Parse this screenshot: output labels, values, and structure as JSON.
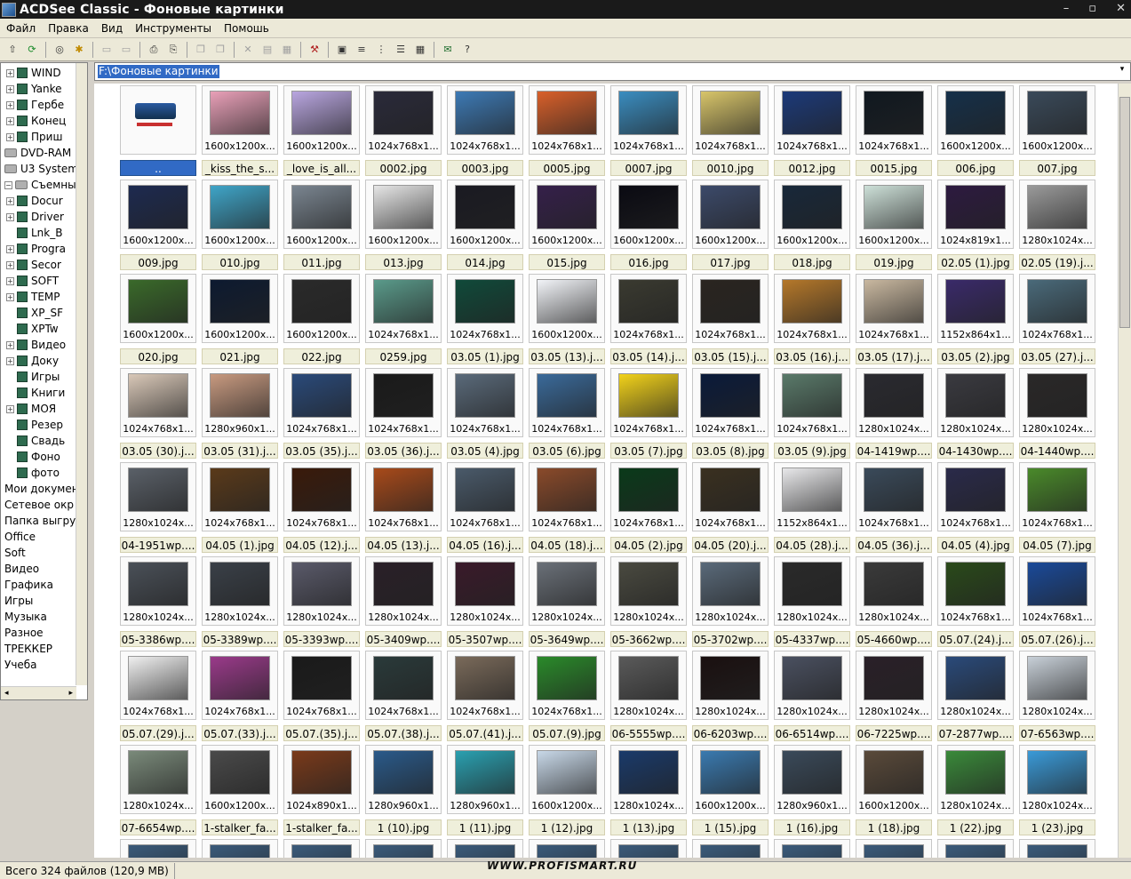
{
  "window": {
    "title": "ACDSee Classic - Фоновые картинки",
    "min": "–",
    "max": "▫",
    "close": "✕"
  },
  "menu": [
    "Файл",
    "Правка",
    "Вид",
    "Инструменты",
    "Помошь"
  ],
  "toolbar": [
    "up-icon",
    "refresh-icon",
    "binoculars-icon",
    "favorite-icon",
    "view-icon",
    "compare-icon",
    "print-icon",
    "scan-icon",
    "copy-icon",
    "paste-icon",
    "delete-icon",
    "rename-icon",
    "properties-icon",
    "tools-icon",
    "thumbs-icon",
    "list-icon",
    "tree-icon",
    "details-icon",
    "grid-icon",
    "email-icon",
    "help-icon"
  ],
  "tree": [
    {
      "label": "WIND",
      "type": "folder",
      "expander": "+"
    },
    {
      "label": "Yanke",
      "type": "folder",
      "expander": "+"
    },
    {
      "label": "Гербе",
      "type": "folder",
      "expander": "+"
    },
    {
      "label": "Конец",
      "type": "folder",
      "expander": "+"
    },
    {
      "label": "Приш",
      "type": "folder",
      "expander": "+"
    },
    {
      "label": "DVD-RAM",
      "type": "drive",
      "expander": ""
    },
    {
      "label": "U3 System",
      "type": "drive",
      "expander": ""
    },
    {
      "label": "Съемный",
      "type": "drive",
      "expander": "−"
    },
    {
      "label": "Docur",
      "type": "folder",
      "expander": "+"
    },
    {
      "label": "Driver",
      "type": "folder",
      "expander": "+"
    },
    {
      "label": "Lnk_B",
      "type": "folder",
      "expander": ""
    },
    {
      "label": "Progra",
      "type": "folder",
      "expander": "+"
    },
    {
      "label": "Secor",
      "type": "folder",
      "expander": "+"
    },
    {
      "label": "SOFT",
      "type": "folder",
      "expander": "+"
    },
    {
      "label": "TEMP",
      "type": "folder",
      "expander": "+"
    },
    {
      "label": "XP_SF",
      "type": "folder",
      "expander": ""
    },
    {
      "label": "XPTw",
      "type": "folder",
      "expander": ""
    },
    {
      "label": "Видео",
      "type": "folder",
      "expander": "+"
    },
    {
      "label": "Доку",
      "type": "folder",
      "expander": "+"
    },
    {
      "label": "Игры",
      "type": "folder",
      "expander": ""
    },
    {
      "label": "Книги",
      "type": "folder",
      "expander": ""
    },
    {
      "label": "МОЯ",
      "type": "folder",
      "expander": "+"
    },
    {
      "label": "Резер",
      "type": "folder",
      "expander": ""
    },
    {
      "label": "Свадь",
      "type": "folder",
      "expander": ""
    },
    {
      "label": "Фоно",
      "type": "folder",
      "expander": ""
    },
    {
      "label": "фото",
      "type": "folder",
      "expander": ""
    },
    {
      "label": "Мои докумен",
      "type": "plain",
      "expander": ""
    },
    {
      "label": "Сетевое окр",
      "type": "plain",
      "expander": ""
    },
    {
      "label": "Папка выгру",
      "type": "plain",
      "expander": ""
    },
    {
      "label": "Office",
      "type": "plain",
      "expander": ""
    },
    {
      "label": "Soft",
      "type": "plain",
      "expander": ""
    },
    {
      "label": "Видео",
      "type": "plain",
      "expander": ""
    },
    {
      "label": "Графика",
      "type": "plain",
      "expander": ""
    },
    {
      "label": "Игры",
      "type": "plain",
      "expander": ""
    },
    {
      "label": "Музыка",
      "type": "plain",
      "expander": ""
    },
    {
      "label": "Разное",
      "type": "plain",
      "expander": ""
    },
    {
      "label": "ТРЕККЕР",
      "type": "plain",
      "expander": ""
    },
    {
      "label": "Учеба",
      "type": "plain",
      "expander": ""
    }
  ],
  "tree_scroll": {
    "left": "◂",
    "right": "▸"
  },
  "path": {
    "value": "F:\\Фоновые картинки",
    "dropdown": "▾"
  },
  "tiles": [
    {
      "dim": "",
      "name": "..",
      "color": "#ffffff",
      "selected": true
    },
    {
      "dim": "1600x1200x...",
      "name": "_kiss_the_s...",
      "color": "#e9a0b8"
    },
    {
      "dim": "1600x1200x...",
      "name": "_love_is_all...",
      "color": "#b9a6e0"
    },
    {
      "dim": "1024x768x1...",
      "name": "0002.jpg",
      "color": "#2a2a3a"
    },
    {
      "dim": "1024x768x1...",
      "name": "0003.jpg",
      "color": "#3d7ab5"
    },
    {
      "dim": "1024x768x1...",
      "name": "0005.jpg",
      "color": "#d9602a"
    },
    {
      "dim": "1024x768x1...",
      "name": "0007.jpg",
      "color": "#3a8dc0"
    },
    {
      "dim": "1024x768x1...",
      "name": "0010.jpg",
      "color": "#d8c56a"
    },
    {
      "dim": "1024x768x1...",
      "name": "0012.jpg",
      "color": "#1c3a7a"
    },
    {
      "dim": "1024x768x1...",
      "name": "0015.jpg",
      "color": "#101820"
    },
    {
      "dim": "1600x1200x...",
      "name": "006.jpg",
      "color": "#15304a"
    },
    {
      "dim": "1600x1200x...",
      "name": "007.jpg",
      "color": "#3a4a5a"
    },
    {
      "dim": "1600x1200x...",
      "name": "009.jpg",
      "color": "#1d2a50"
    },
    {
      "dim": "1600x1200x...",
      "name": "010.jpg",
      "color": "#3fa5c8"
    },
    {
      "dim": "1600x1200x...",
      "name": "011.jpg",
      "color": "#7a8590"
    },
    {
      "dim": "1600x1200x...",
      "name": "013.jpg",
      "color": "#e6e6e6"
    },
    {
      "dim": "1600x1200x...",
      "name": "014.jpg",
      "color": "#1a1a22"
    },
    {
      "dim": "1600x1200x...",
      "name": "015.jpg",
      "color": "#35204a"
    },
    {
      "dim": "1600x1200x...",
      "name": "016.jpg",
      "color": "#0a0a12"
    },
    {
      "dim": "1600x1200x...",
      "name": "017.jpg",
      "color": "#3c4a6a"
    },
    {
      "dim": "1600x1200x...",
      "name": "018.jpg",
      "color": "#18283a"
    },
    {
      "dim": "1600x1200x...",
      "name": "019.jpg",
      "color": "#cde0d8"
    },
    {
      "dim": "1024x819x1...",
      "name": "02.05 (1).jpg",
      "color": "#2d1a40"
    },
    {
      "dim": "1280x1024x...",
      "name": "02.05 (19).j...",
      "color": "#9a9a9a"
    },
    {
      "dim": "1600x1200x...",
      "name": "020.jpg",
      "color": "#3a6a2a"
    },
    {
      "dim": "1600x1200x...",
      "name": "021.jpg",
      "color": "#0d1a30"
    },
    {
      "dim": "1600x1200x...",
      "name": "022.jpg",
      "color": "#2a2a2a"
    },
    {
      "dim": "1024x768x1...",
      "name": "0259.jpg",
      "color": "#5a9a8a"
    },
    {
      "dim": "1024x768x1...",
      "name": "03.05 (1).jpg",
      "color": "#104a3a"
    },
    {
      "dim": "1600x1200x...",
      "name": "03.05 (13).j...",
      "color": "#f2f4f8"
    },
    {
      "dim": "1024x768x1...",
      "name": "03.05 (14).j...",
      "color": "#3a3a30"
    },
    {
      "dim": "1024x768x1...",
      "name": "03.05 (15).j...",
      "color": "#2a2520"
    },
    {
      "dim": "1024x768x1...",
      "name": "03.05 (16).j...",
      "color": "#b5782a"
    },
    {
      "dim": "1024x768x1...",
      "name": "03.05 (17).j...",
      "color": "#c9b8a0"
    },
    {
      "dim": "1152x864x1...",
      "name": "03.05 (2).jpg",
      "color": "#3a2a6a"
    },
    {
      "dim": "1024x768x1...",
      "name": "03.05 (27).j...",
      "color": "#4a6a7a"
    },
    {
      "dim": "1024x768x1...",
      "name": "03.05 (30).j...",
      "color": "#d9c8b8"
    },
    {
      "dim": "1280x960x1...",
      "name": "03.05 (31).j...",
      "color": "#c89a80"
    },
    {
      "dim": "1024x768x1...",
      "name": "03.05 (35).j...",
      "color": "#2a4a7a"
    },
    {
      "dim": "1024x768x1...",
      "name": "03.05 (36).j...",
      "color": "#1a1a1a"
    },
    {
      "dim": "1024x768x1...",
      "name": "03.05 (4).jpg",
      "color": "#5a6a7a"
    },
    {
      "dim": "1024x768x1...",
      "name": "03.05 (6).jpg",
      "color": "#3a6a9a"
    },
    {
      "dim": "1024x768x1...",
      "name": "03.05 (7).jpg",
      "color": "#f2d21a"
    },
    {
      "dim": "1024x768x1...",
      "name": "03.05 (8).jpg",
      "color": "#0a1a3a"
    },
    {
      "dim": "1024x768x1...",
      "name": "03.05 (9).jpg",
      "color": "#5a7a6a"
    },
    {
      "dim": "1280x1024x...",
      "name": "04-1419wp....",
      "color": "#2a2a30"
    },
    {
      "dim": "1280x1024x...",
      "name": "04-1430wp....",
      "color": "#3a3a40"
    },
    {
      "dim": "1280x1024x...",
      "name": "04-1440wp....",
      "color": "#2a2828"
    },
    {
      "dim": "1280x1024x...",
      "name": "04-1951wp....",
      "color": "#5a6068"
    },
    {
      "dim": "1024x768x1...",
      "name": "04.05 (1).jpg",
      "color": "#5a3a1a"
    },
    {
      "dim": "1024x768x1...",
      "name": "04.05 (12).j...",
      "color": "#3a1a0a"
    },
    {
      "dim": "1024x768x1...",
      "name": "04.05 (13).j...",
      "color": "#a84a1a"
    },
    {
      "dim": "1024x768x1...",
      "name": "04.05 (16).j...",
      "color": "#4a5a6a"
    },
    {
      "dim": "1024x768x1...",
      "name": "04.05 (18).j...",
      "color": "#8a4a2a"
    },
    {
      "dim": "1024x768x1...",
      "name": "04.05 (2).jpg",
      "color": "#0a3a1a"
    },
    {
      "dim": "1024x768x1...",
      "name": "04.05 (20).j...",
      "color": "#3a3020"
    },
    {
      "dim": "1152x864x1...",
      "name": "04.05 (28).j...",
      "color": "#e8e8ea"
    },
    {
      "dim": "1024x768x1...",
      "name": "04.05 (36).j...",
      "color": "#3a4a5a"
    },
    {
      "dim": "1024x768x1...",
      "name": "04.05 (4).jpg",
      "color": "#2a2a4a"
    },
    {
      "dim": "1024x768x1...",
      "name": "04.05 (7).jpg",
      "color": "#4a8a2a"
    },
    {
      "dim": "1280x1024x...",
      "name": "05-3386wp....",
      "color": "#4a5058"
    },
    {
      "dim": "1280x1024x...",
      "name": "05-3389wp....",
      "color": "#3a4048"
    },
    {
      "dim": "1280x1024x...",
      "name": "05-3393wp....",
      "color": "#5a5a6a"
    },
    {
      "dim": "1280x1024x...",
      "name": "05-3409wp....",
      "color": "#2a2028"
    },
    {
      "dim": "1280x1024x...",
      "name": "05-3507wp....",
      "color": "#3a1a2a"
    },
    {
      "dim": "1280x1024x...",
      "name": "05-3649wp....",
      "color": "#6a7078"
    },
    {
      "dim": "1280x1024x...",
      "name": "05-3662wp....",
      "color": "#4a4a40"
    },
    {
      "dim": "1280x1024x...",
      "name": "05-3702wp....",
      "color": "#5a6a7a"
    },
    {
      "dim": "1280x1024x...",
      "name": "05-4337wp....",
      "color": "#2a2a2a"
    },
    {
      "dim": "1280x1024x...",
      "name": "05-4660wp....",
      "color": "#3a3a3a"
    },
    {
      "dim": "1024x768x1...",
      "name": "05.07.(24).j...",
      "color": "#2a4a1a"
    },
    {
      "dim": "1024x768x1...",
      "name": "05.07.(26).j...",
      "color": "#1a4a9a"
    },
    {
      "dim": "1024x768x1...",
      "name": "05.07.(29).j...",
      "color": "#f0f0f0"
    },
    {
      "dim": "1024x768x1...",
      "name": "05.07.(33).j...",
      "color": "#9a3a8a"
    },
    {
      "dim": "1024x768x1...",
      "name": "05.07.(35).j...",
      "color": "#1a1a1a"
    },
    {
      "dim": "1024x768x1...",
      "name": "05.07.(38).j...",
      "color": "#2a3a3a"
    },
    {
      "dim": "1024x768x1...",
      "name": "05.07.(41).j...",
      "color": "#7a6a5a"
    },
    {
      "dim": "1024x768x1...",
      "name": "05.07.(9).jpg",
      "color": "#2a8a2a"
    },
    {
      "dim": "1280x1024x...",
      "name": "06-5555wp....",
      "color": "#5a5a5a"
    },
    {
      "dim": "1280x1024x...",
      "name": "06-6203wp....",
      "color": "#1a1010"
    },
    {
      "dim": "1280x1024x...",
      "name": "06-6514wp....",
      "color": "#4a5060"
    },
    {
      "dim": "1280x1024x...",
      "name": "06-7225wp....",
      "color": "#2a2028"
    },
    {
      "dim": "1280x1024x...",
      "name": "07-2877wp....",
      "color": "#2a4a7a"
    },
    {
      "dim": "1280x1024x...",
      "name": "07-6563wp....",
      "color": "#c8d0d8"
    },
    {
      "dim": "1280x1024x...",
      "name": "07-6654wp....",
      "color": "#7a8a7a"
    },
    {
      "dim": "1600x1200x...",
      "name": "1-stalker_fa...",
      "color": "#4a4a4a"
    },
    {
      "dim": "1024x890x1...",
      "name": "1-stalker_fa...",
      "color": "#7a3a1a"
    },
    {
      "dim": "1280x960x1...",
      "name": "1 (10).jpg",
      "color": "#2a5a8a"
    },
    {
      "dim": "1280x960x1...",
      "name": "1 (11).jpg",
      "color": "#2aa0b0"
    },
    {
      "dim": "1600x1200x...",
      "name": "1 (12).jpg",
      "color": "#c8d8e8"
    },
    {
      "dim": "1280x1024x...",
      "name": "1 (13).jpg",
      "color": "#1a3a6a"
    },
    {
      "dim": "1600x1200x...",
      "name": "1 (15).jpg",
      "color": "#3a7ab0"
    },
    {
      "dim": "1280x960x1...",
      "name": "1 (16).jpg",
      "color": "#3a4a5a"
    },
    {
      "dim": "1600x1200x...",
      "name": "1 (18).jpg",
      "color": "#5a4a3a"
    },
    {
      "dim": "1280x1024x...",
      "name": "1 (22).jpg",
      "color": "#3a8a3a"
    },
    {
      "dim": "1280x1024x...",
      "name": "1 (23).jpg",
      "color": "#3a9ad8"
    }
  ],
  "status": {
    "files": "Всего 324 файлов (120,9 MB)"
  },
  "watermark": "WWW.PROFISMART.RU"
}
